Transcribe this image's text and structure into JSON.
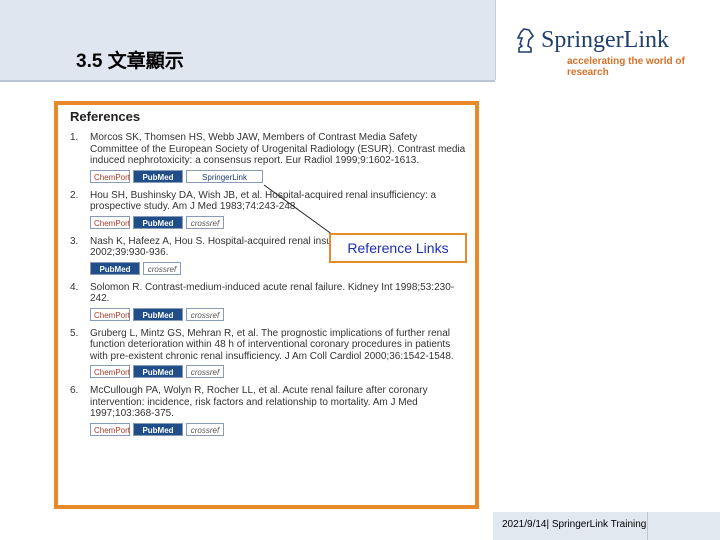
{
  "header": {
    "slide_title": "3.5 文章顯示",
    "logo_name": "SpringerLink",
    "logo_tagline": "accelerating the world of research"
  },
  "references": {
    "heading": "References",
    "items": [
      {
        "num": "1.",
        "text": "Morcos SK, Thomsen HS, Webb JAW, Members of Contrast Media Safety Committee of the European Society of Urogenital Radiology (ESUR). Contrast media induced nephrotoxicity: a consensus report. Eur Radiol 1999;9:1602-1613.",
        "links": [
          "ChemPort",
          "PubMed",
          "SpringerLink"
        ]
      },
      {
        "num": "2.",
        "text": "Hou SH, Bushinsky DA, Wish JB, et al. Hospital-acquired renal insufficiency: a prospective study. Am J Med 1983;74:243-248.",
        "links": [
          "ChemPort",
          "PubMed",
          "crossref"
        ]
      },
      {
        "num": "3.",
        "text": "Nash K, Hafeez A, Hou S. Hospital-acquired renal insufficiency. Am J Kidney Dis 2002;39:930-936.",
        "links": [
          "PubMed",
          "crossref"
        ]
      },
      {
        "num": "4.",
        "text": "Solomon R. Contrast-medium-induced acute renal failure. Kidney Int 1998;53:230-242.",
        "links": [
          "ChemPort",
          "PubMed",
          "crossref"
        ]
      },
      {
        "num": "5.",
        "text": "Gruberg L, Mintz GS, Mehran R, et al. The prognostic implications of further renal function deterioration within 48 h of interventional coronary procedures in patients with pre-existent chronic renal insufficiency. J Am Coll Cardiol 2000;36:1542-1548.",
        "links": [
          "ChemPort",
          "PubMed",
          "crossref"
        ]
      },
      {
        "num": "6.",
        "text": "McCullough PA, Wolyn R, Rocher LL, et al. Acute renal failure after coronary intervention: incidence, risk factors and relationship to mortality. Am J Med 1997;103:368-375.",
        "links": [
          "ChemPort",
          "PubMed",
          "crossref"
        ]
      }
    ]
  },
  "callout": {
    "label": "Reference Links"
  },
  "footer": {
    "text": "2021/9/14| SpringerLink Training"
  }
}
